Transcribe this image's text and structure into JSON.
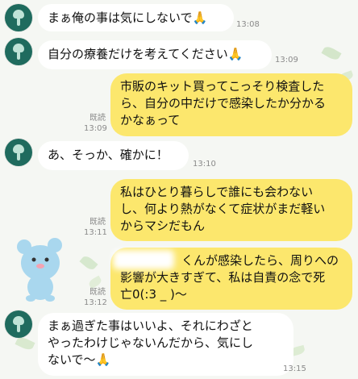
{
  "messages": [
    {
      "side": "in",
      "lines": [
        "まぁ俺の事は気にしないで🙏"
      ],
      "time": "13:08"
    },
    {
      "side": "in",
      "lines": [
        "自分の療養だけを考えてください🙏"
      ],
      "time": "13:09"
    },
    {
      "side": "out",
      "lines": [
        "市販のキット買ってこっそり検査した",
        "ら、自分の中だけで感染したか分かる",
        "かなぁって"
      ],
      "read": "既読",
      "time": "13:09"
    },
    {
      "side": "in",
      "lines": [
        "あ、そっか、確かに！"
      ],
      "time": "13:10"
    },
    {
      "side": "out",
      "lines": [
        "私はひとり暮らしで誰にも会わない",
        "し、何より熱がなくて症状がまだ軽い",
        "からマシだもん"
      ],
      "read": "既読",
      "time": "13:11"
    },
    {
      "side": "out",
      "lines": [
        "くんが感染したら、周りへの",
        "影響が大きすぎて、私は自責の念で死",
        "亡0(:3 _ )〜"
      ],
      "read": "既読",
      "time": "13:12"
    },
    {
      "side": "in",
      "lines": [
        "まぁ過ぎた事はいいよ、それにわざと",
        "やったわけじゃないんだから、気にし",
        "ないで〜🙏"
      ],
      "time": "13:15"
    }
  ],
  "colors": {
    "outgoing": "#fce76d",
    "incoming": "#ffffff",
    "avatar": "#1f6b5e"
  },
  "icons": {
    "avatar": "avatar-icon",
    "decor": "bear-sticker-icon"
  }
}
